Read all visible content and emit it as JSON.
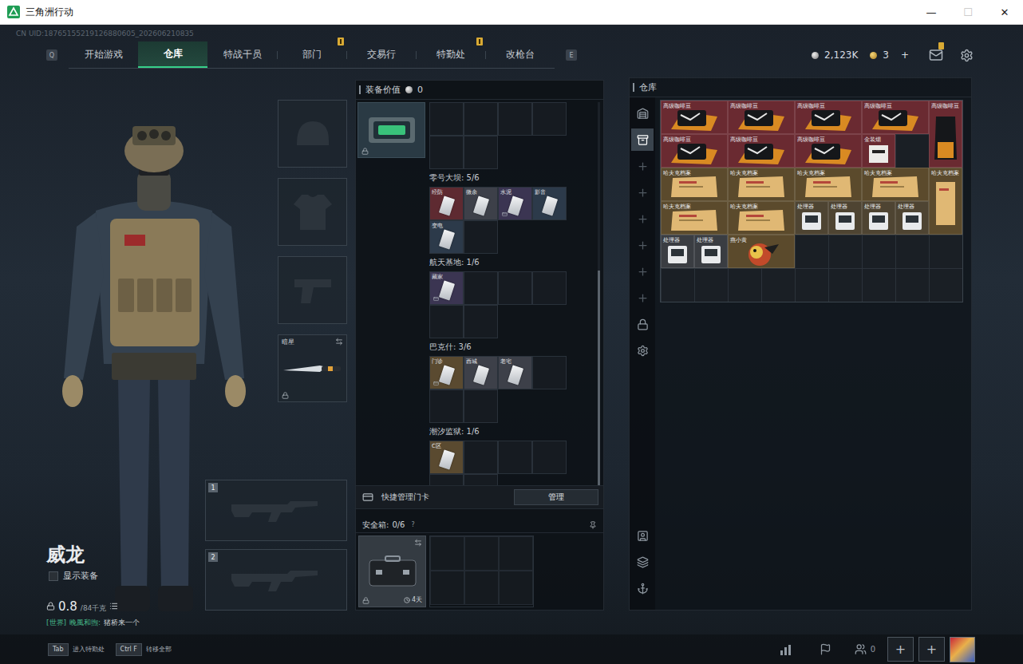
{
  "window": {
    "title": "三角洲行动",
    "controls": [
      {
        "glyph": "—",
        "disabled": false
      },
      {
        "glyph": "☐",
        "disabled": true
      },
      {
        "glyph": "✕",
        "disabled": false
      }
    ]
  },
  "uid": "CN UID:18765155219126880605_202606210835",
  "nav": {
    "prev_key": "Q",
    "next_key": "E",
    "tabs": [
      {
        "label": "开始游戏",
        "selected": false,
        "badge": false
      },
      {
        "label": "仓库",
        "selected": true,
        "badge": false
      },
      {
        "label": "特战干员",
        "selected": false,
        "badge": false
      },
      {
        "label": "部门",
        "selected": false,
        "badge": true
      },
      {
        "label": "交易行",
        "selected": false,
        "badge": false
      },
      {
        "label": "特勤处",
        "selected": false,
        "badge": true
      },
      {
        "label": "改枪台",
        "selected": false,
        "badge": false
      }
    ]
  },
  "currency": {
    "coins": "2,123K",
    "tickets": "3",
    "add": "+",
    "mail_badge": true
  },
  "operator": {
    "name": "威龙",
    "show_gear_label": "显示装备",
    "show_gear_checked": false,
    "weight": "0.8",
    "weight_max": "/84千克"
  },
  "chat": {
    "channel": "[世界]",
    "sender": "晚風和煦:",
    "message": "猪桥来一个"
  },
  "gear_slots": [
    {
      "kind": "helmet",
      "locked": false,
      "swappable": false
    },
    {
      "kind": "armor",
      "locked": false,
      "swappable": false
    },
    {
      "kind": "pistol",
      "locked": false,
      "swappable": false
    },
    {
      "kind": "melee",
      "label": "暗星",
      "locked": true,
      "swappable": true
    }
  ],
  "weapon_slots": [
    {
      "number": "1"
    },
    {
      "number": "2"
    }
  ],
  "loadout": {
    "title": "装备价值",
    "value": "0"
  },
  "keycards": {
    "case_locked": true,
    "scrollbar": {
      "level": 0.56
    },
    "sections": [
      {
        "label": "零号大坝: 5/6",
        "cards": [
          {
            "label": "经防",
            "color": "#5e2a31",
            "marked": false
          },
          {
            "label": "微余",
            "color": "#3d4049",
            "marked": false
          },
          {
            "label": "水泥",
            "color": "#3b3552",
            "marked": true
          },
          {
            "label": "影音",
            "color": "#2c3a4a",
            "marked": false
          },
          {
            "label": "变电",
            "color": "#2c3a4a",
            "marked": false
          }
        ]
      },
      {
        "label": "航天基地: 1/6",
        "cards": [
          {
            "label": "藏家",
            "color": "#3b3552",
            "marked": true
          }
        ]
      },
      {
        "label": "巴克什: 3/6",
        "cards": [
          {
            "label": "门诊",
            "color": "#5a4a30",
            "marked": true
          },
          {
            "label": "西城",
            "color": "#3d4049",
            "marked": false
          },
          {
            "label": "老宅",
            "color": "#3d4049",
            "marked": false
          }
        ]
      },
      {
        "label": "潮汐监狱: 1/6",
        "cards": [
          {
            "label": "C区",
            "color": "#5a4a30",
            "marked": false
          }
        ]
      }
    ]
  },
  "quick_manage": {
    "label": "快捷管理门卡",
    "button": "管理"
  },
  "safe_box": {
    "title": "安全箱:",
    "count": "0/6",
    "help": "?",
    "timer": "4天",
    "locked": true,
    "swappable": true
  },
  "warehouse": {
    "title": "仓库",
    "sidebar": [
      {
        "selected": false
      },
      {
        "selected": true
      },
      {
        "selected": false
      },
      {
        "selected": false
      },
      {
        "selected": false
      },
      {
        "selected": false
      },
      {
        "selected": false
      },
      {
        "selected": false
      },
      {
        "selected": false
      },
      {
        "selected": false
      },
      {
        "selected": false
      },
      {
        "selected": false
      },
      {
        "selected": false
      }
    ],
    "items": [
      {
        "label": "高级咖啡豆",
        "kind": "coffee",
        "color": "#6a2a31"
      },
      {
        "label": "高级咖啡豆",
        "kind": "coffee",
        "color": "#6a2a31"
      },
      {
        "label": "高级咖啡豆",
        "kind": "coffee",
        "color": "#6a2a31"
      },
      {
        "label": "高级咖啡豆",
        "kind": "coffee",
        "color": "#6a2a31"
      },
      {
        "label": "高级咖啡豆",
        "kind": "coffee-tall",
        "color": "#6a2a31"
      },
      {
        "label": "高级咖啡豆",
        "kind": "coffee",
        "color": "#6a2a31"
      },
      {
        "label": "高级咖啡豆",
        "kind": "coffee",
        "color": "#6a2a31"
      },
      {
        "label": "高级咖啡豆",
        "kind": "coffee",
        "color": "#6a2a31"
      },
      {
        "label": "金装烟",
        "kind": "box",
        "color": "#6a2a31"
      },
      {
        "label": "哈夫克档案",
        "kind": "folder",
        "color": "#5b4a2c"
      },
      {
        "label": "哈夫克档案",
        "kind": "folder",
        "color": "#5b4a2c"
      },
      {
        "label": "哈夫克档案",
        "kind": "folder",
        "color": "#5b4a2c"
      },
      {
        "label": "哈夫克档案",
        "kind": "folder",
        "color": "#5b4a2c"
      },
      {
        "label": "哈夫克档案",
        "kind": "folder-tall",
        "color": "#5b4a2c"
      },
      {
        "label": "哈夫克档案",
        "kind": "folder",
        "color": "#5b4a2c"
      },
      {
        "label": "哈夫克档案",
        "kind": "folder",
        "color": "#5b4a2c"
      },
      {
        "label": "处理器",
        "kind": "device",
        "color": "#4e4432"
      },
      {
        "label": "处理器",
        "kind": "device",
        "color": "#4e4432"
      },
      {
        "label": "处理器",
        "kind": "device",
        "color": "#4e4432"
      },
      {
        "label": "处理器",
        "kind": "device",
        "color": "#4e4432"
      },
      {
        "label": "处理器",
        "kind": "device",
        "color": "#3a3d42"
      },
      {
        "label": "处理器",
        "kind": "device",
        "color": "#3a3d42"
      },
      {
        "label": "燕小黄",
        "kind": "bird",
        "color": "#5b4a2c"
      }
    ]
  },
  "bottom": {
    "hints": [
      {
        "key": "Tab",
        "label": "进入特勤处"
      },
      {
        "key": "Ctrl F",
        "label": "转移全部"
      }
    ],
    "friends": "0",
    "party_slots": [
      "+",
      "+"
    ]
  }
}
